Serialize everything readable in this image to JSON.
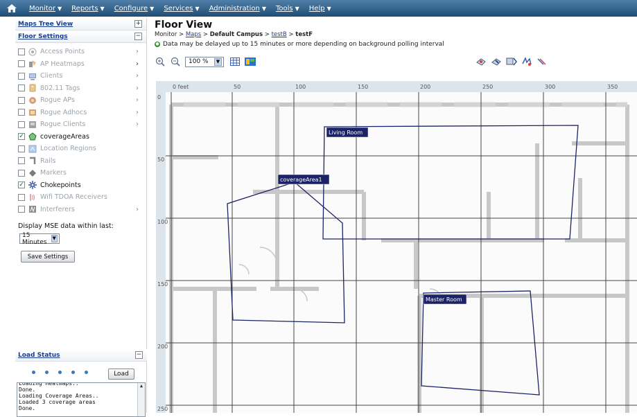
{
  "menu": [
    "Monitor",
    "Reports",
    "Configure",
    "Services",
    "Administration",
    "Tools",
    "Help"
  ],
  "left_panel": {
    "maps_tree_view": "Maps Tree View",
    "floor_settings": "Floor Settings",
    "layers": [
      {
        "label": "Access Points",
        "checked": false,
        "enabled": false,
        "chevron": true,
        "icon": "access-point-icon"
      },
      {
        "label": "AP Heatmaps",
        "checked": false,
        "enabled": false,
        "chevron": true,
        "icon": "heatmap-icon"
      },
      {
        "label": "Clients",
        "checked": false,
        "enabled": false,
        "chevron": true,
        "icon": "client-icon"
      },
      {
        "label": "802.11 Tags",
        "checked": false,
        "enabled": false,
        "chevron": true,
        "icon": "tag-icon"
      },
      {
        "label": "Rogue APs",
        "checked": false,
        "enabled": false,
        "chevron": true,
        "icon": "rogue-ap-icon"
      },
      {
        "label": "Rogue Adhocs",
        "checked": false,
        "enabled": false,
        "chevron": true,
        "icon": "rogue-adhoc-icon"
      },
      {
        "label": "Rogue Clients",
        "checked": false,
        "enabled": false,
        "chevron": true,
        "icon": "rogue-client-icon"
      },
      {
        "label": "coverageAreas",
        "checked": true,
        "enabled": true,
        "chevron": false,
        "icon": "coverage-area-icon"
      },
      {
        "label": "Location Regions",
        "checked": false,
        "enabled": false,
        "chevron": false,
        "icon": "location-region-icon"
      },
      {
        "label": "Rails",
        "checked": false,
        "enabled": false,
        "chevron": false,
        "icon": "rail-icon"
      },
      {
        "label": "Markers",
        "checked": false,
        "enabled": false,
        "chevron": false,
        "icon": "marker-icon"
      },
      {
        "label": "Chokepoints",
        "checked": true,
        "enabled": true,
        "chevron": false,
        "icon": "chokepoint-icon"
      },
      {
        "label": "Wifi TDOA Receivers",
        "checked": false,
        "enabled": false,
        "chevron": false,
        "icon": "tdoa-receiver-icon"
      },
      {
        "label": "Interferers",
        "checked": false,
        "enabled": false,
        "chevron": true,
        "icon": "interferer-icon"
      }
    ],
    "mse_label": "Display MSE data within last:",
    "mse_value": "15 Minutes",
    "save_label": "Save Settings",
    "load_status": "Load Status",
    "load_label": "Load",
    "log_lines": [
      "Loading Heatmaps..",
      "Done.",
      "Loading Coverage Areas..",
      "Loaded 3 coverage areas",
      "Done."
    ]
  },
  "main": {
    "title": "Floor View",
    "breadcrumb": {
      "monitor": "Monitor",
      "sep": " > ",
      "maps": "Maps",
      "campus": "Default Campus",
      "building": "testB",
      "floor": "testF"
    },
    "notice": "Data may be delayed up to 15 minutes or more depending on background polling interval",
    "zoom": "100 %"
  },
  "map": {
    "x_ruler": [
      "0 feet",
      "50",
      "100",
      "150",
      "200",
      "250",
      "300",
      "350"
    ],
    "y_ruler": [
      "0",
      "50",
      "100",
      "150",
      "200",
      "250"
    ],
    "areas": [
      "Living Room",
      "coverageArea1",
      "Master Room"
    ]
  },
  "colors": {
    "menubar": "#2a5a85",
    "area_stroke": "#1c2266",
    "area_label_bg": "#1c2266",
    "walls": "#c8c8c8"
  }
}
